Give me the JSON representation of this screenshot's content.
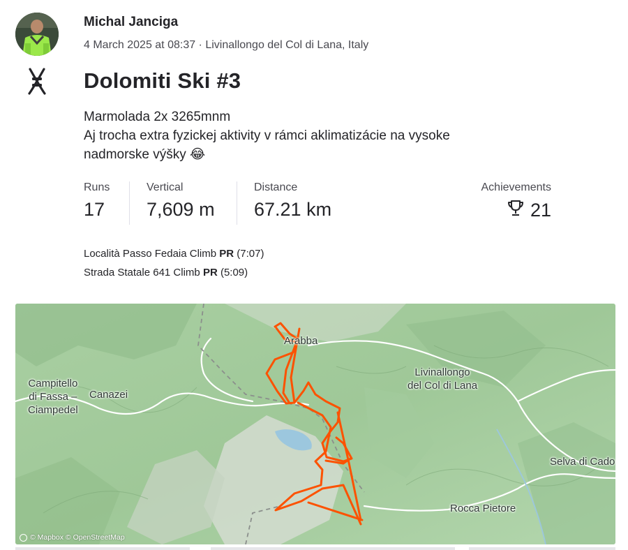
{
  "author": {
    "name": "Michal Janciga",
    "meta": "4 March 2025 at 08:37 · Livinallongo del Col di Lana, Italy"
  },
  "activity": {
    "sport_icon": "ski-icon",
    "title": "Dolomiti Ski #3",
    "description_lines": [
      "Marmolada 2x 3265mnm",
      "Aj trocha extra fyzickej aktivity v rámci aklimatizácie na vysoke",
      "nadmorske výšky 😂"
    ]
  },
  "stats": {
    "runs": {
      "label": "Runs",
      "value": "17"
    },
    "vertical": {
      "label": "Vertical",
      "value": "7,609 m"
    },
    "distance": {
      "label": "Distance",
      "value": "67.21 km"
    },
    "achievements": {
      "label": "Achievements",
      "value": "21",
      "icon": "trophy-icon"
    }
  },
  "segments": [
    {
      "name": "Località Passo Fedaia Climb",
      "badge": "PR",
      "time": "(7:07)"
    },
    {
      "name": "Strada Statale 641 Climb",
      "badge": "PR",
      "time": "(5:09)"
    }
  ],
  "map": {
    "places": {
      "campitello_1": "Campitello",
      "campitello_2": "di Fassa –",
      "campitello_3": "Ciampedel",
      "canazei": "Canazei",
      "arabba": "Arabba",
      "livinallongo_1": "Livinallongo",
      "livinallongo_2": "del Col di Lana",
      "selva": "Selva di Cado",
      "rocca": "Rocca Pietore"
    },
    "attribution": "© Mapbox © OpenStreetMap",
    "colors": {
      "route": "#fc5200",
      "lake": "#9cc7de",
      "terrain": "#a9cfa2"
    }
  }
}
